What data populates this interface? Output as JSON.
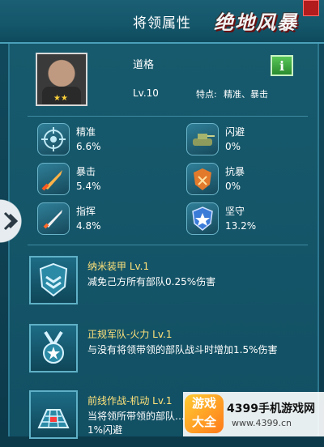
{
  "header": {
    "title": "将领属性",
    "brand": "绝地风暴"
  },
  "hero": {
    "name": "道格",
    "level": "Lv.10",
    "trait_label": "特点:",
    "trait_value": "精准、暴击",
    "stars": 2,
    "info_label": "i"
  },
  "stats": [
    {
      "name": "精准",
      "value": "6.6%",
      "icon": "crosshair-icon"
    },
    {
      "name": "闪避",
      "value": "0%",
      "icon": "tank-icon"
    },
    {
      "name": "暴击",
      "value": "5.4%",
      "icon": "missile-icon"
    },
    {
      "name": "抗暴",
      "value": "0%",
      "icon": "shield-burst-icon"
    },
    {
      "name": "指挥",
      "value": "4.8%",
      "icon": "rocket-icon"
    },
    {
      "name": "坚守",
      "value": "13.2%",
      "icon": "star-shield-icon"
    }
  ],
  "skills": [
    {
      "name": "纳米装甲 Lv.1",
      "desc": "减免己方所有部队0.25%伤害",
      "icon": "chevron-shield-icon"
    },
    {
      "name": "正规军队-火力 Lv.1",
      "desc": "与没有将领带领的部队战斗时增加1.5%伤害",
      "icon": "medal-icon"
    },
    {
      "name": "前线作战-机动 Lv.1",
      "desc": "当将领所带领的部队…\n1%闪避",
      "icon": "grid-icon"
    }
  ],
  "watermark": {
    "logo": "游戏\n大全",
    "name": "4399手机游戏网",
    "url": "www.4399.cn"
  }
}
